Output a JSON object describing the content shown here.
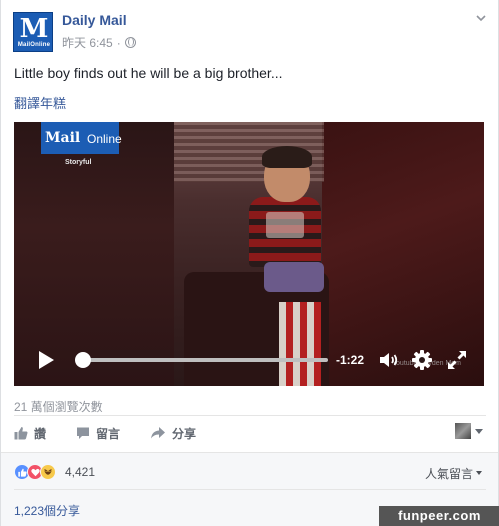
{
  "post": {
    "page_name": "Daily Mail",
    "logo_letter": "M",
    "logo_sub": "MailOnline",
    "timestamp": "昨天 6:45",
    "separator": "·",
    "text": "Little boy finds out he will be a big brother...",
    "translate_link": "翻譯年糕"
  },
  "video": {
    "overlay_brand_main": "Mail",
    "overlay_brand_online": "Online",
    "overlay_credit": "Storyful",
    "watermark": "Youtube/Hayden Mom",
    "time_remaining": "-1:22",
    "progress": 0.02,
    "icons": [
      "play-icon",
      "volume-icon",
      "gear-icon",
      "fullscreen-icon"
    ]
  },
  "stats": {
    "views": "21 萬個瀏覽次數"
  },
  "actions": {
    "like": "讚",
    "comment": "留言",
    "share": "分享"
  },
  "reactions": {
    "count": "4,421",
    "sort_label": "人氣留言",
    "shares": "1,223個分享",
    "types": [
      "like",
      "love",
      "haha"
    ]
  },
  "watermark_site": "funpeer.com",
  "colors": {
    "link_blue": "#365899",
    "brand_blue": "#1c5db4",
    "like_blue": "#5890ff",
    "love_red": "#f25268",
    "haha_yellow": "#f7c94b",
    "muted_gray": "#90949c"
  }
}
